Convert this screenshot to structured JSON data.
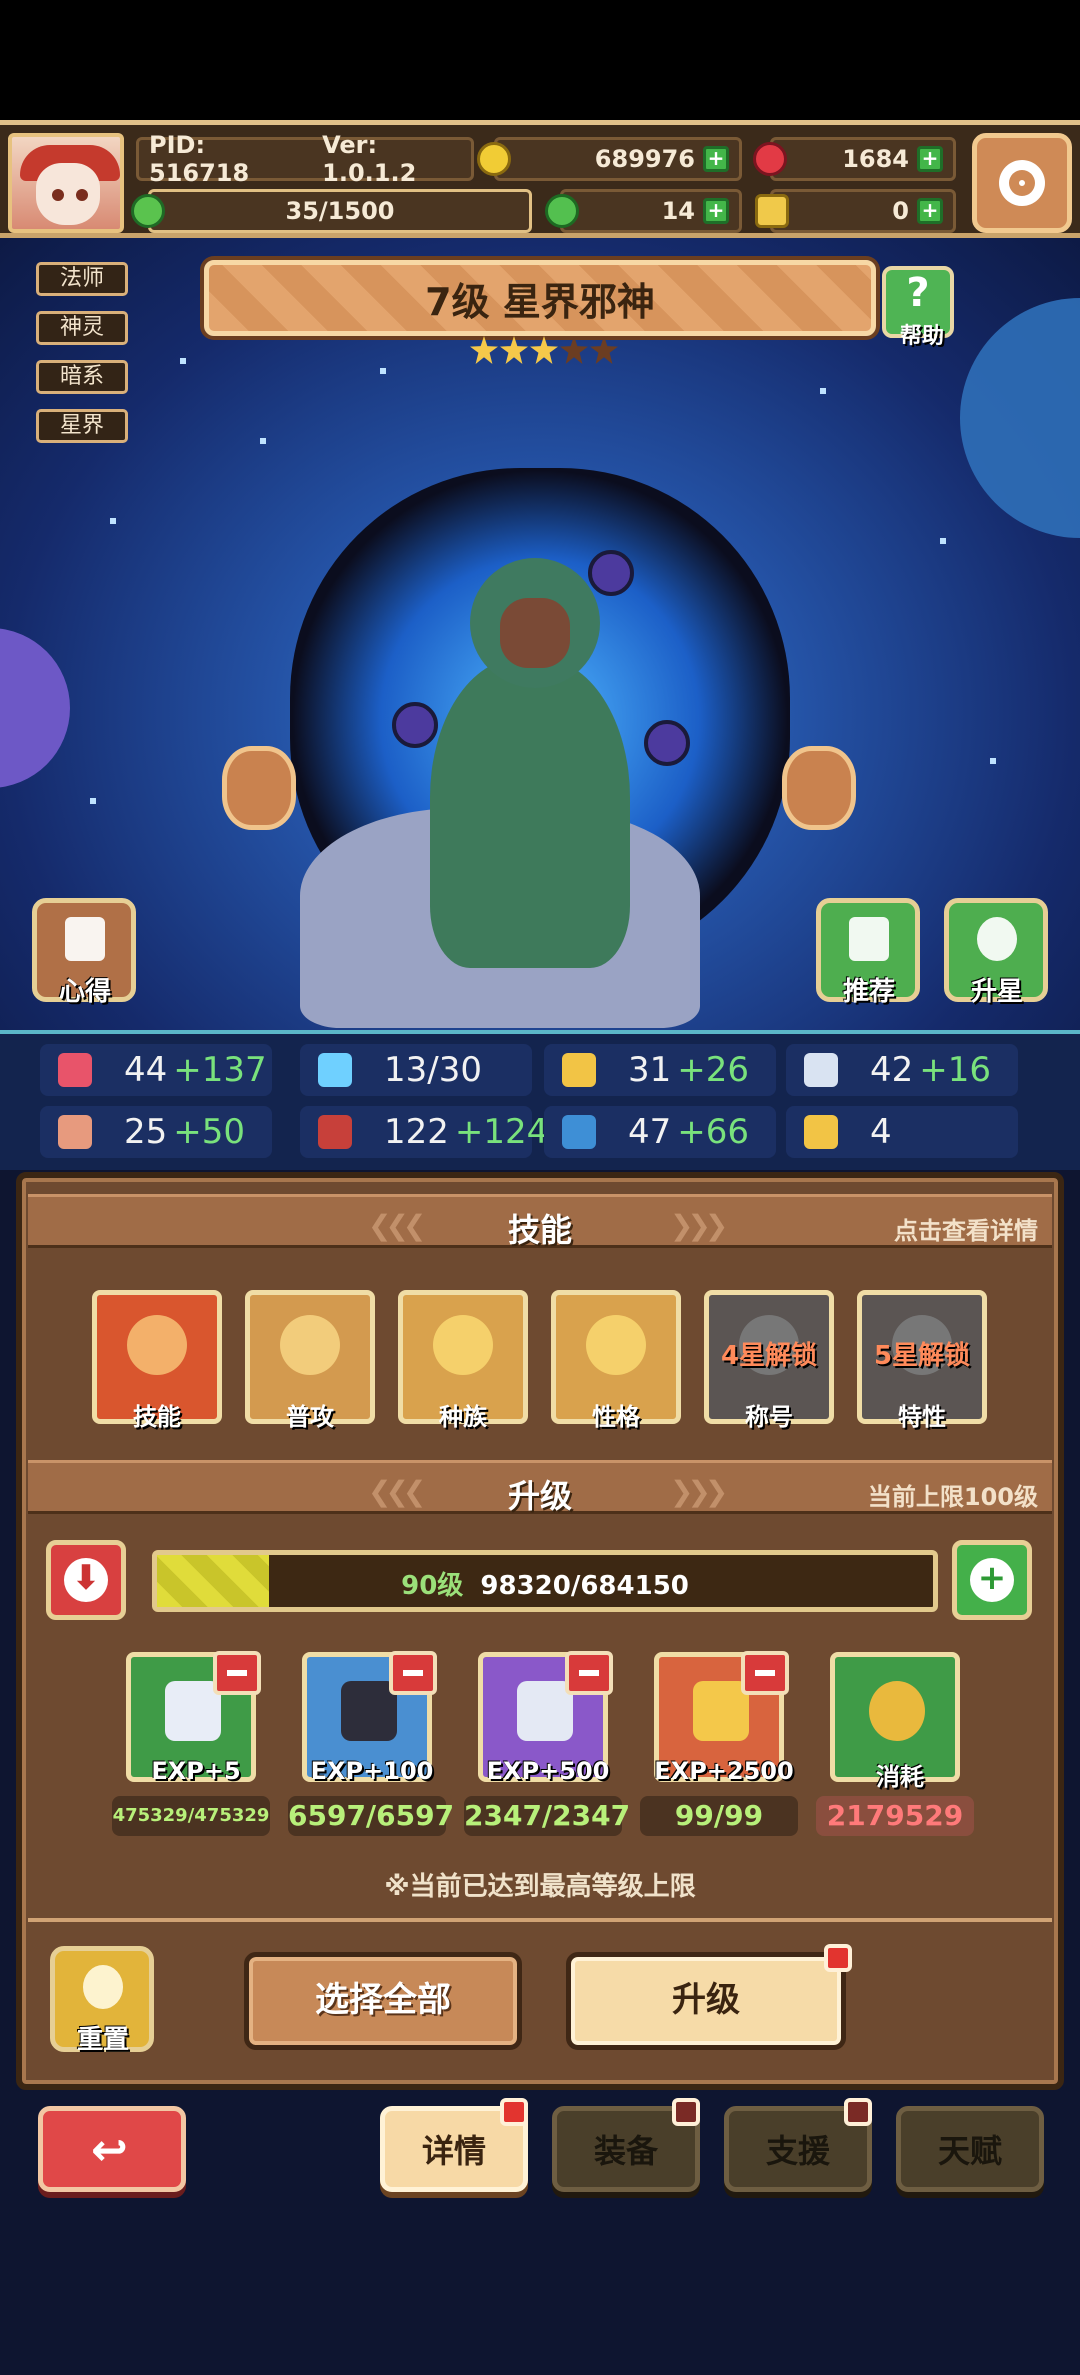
{
  "header": {
    "pid": "PID: 516718",
    "version": "Ver: 1.0.1.2",
    "gold": "689976",
    "gems": "1684",
    "stamina": "35/1500",
    "clover": "14",
    "key": "0"
  },
  "tags": [
    "法师",
    "神灵",
    "暗系",
    "星界"
  ],
  "hero": {
    "title": "7级  星界邪神",
    "stars_filled": 3,
    "stars_total": 5,
    "help_label": "帮助"
  },
  "side_buttons": {
    "notes": "心得",
    "recommend": "推荐",
    "star_up": "升星"
  },
  "stats": [
    {
      "icon": "heart-icon",
      "base": "44",
      "bonus": "+137",
      "color": "#e8546a"
    },
    {
      "icon": "drop-icon",
      "base": "13/30",
      "bonus": "",
      "color": "#6fd0ff"
    },
    {
      "icon": "shield-icon",
      "base": "31",
      "bonus": "+26",
      "color": "#f2c445"
    },
    {
      "icon": "wing-icon",
      "base": "42",
      "bonus": "+16",
      "color": "#d9e3f2"
    },
    {
      "icon": "fist-icon",
      "base": "25",
      "bonus": "+50",
      "color": "#e79a7e"
    },
    {
      "icon": "book-icon",
      "base": "122",
      "bonus": "+124",
      "color": "#c7403a"
    },
    {
      "icon": "boot-icon",
      "base": "47",
      "bonus": "+66",
      "color": "#3e8fd6"
    },
    {
      "icon": "crown-icon",
      "base": "4",
      "bonus": "",
      "color": "#f2c445"
    }
  ],
  "skills_section": {
    "title": "技能",
    "hint": "点击查看详情",
    "items": [
      {
        "label": "技能",
        "lock": "",
        "bg": "#d9562e",
        "art": "#f3b06a"
      },
      {
        "label": "普攻",
        "lock": "",
        "bg": "#d39a4f",
        "art": "#f2cc7b"
      },
      {
        "label": "种族",
        "lock": "",
        "bg": "#d9a24d",
        "art": "#f5d06b"
      },
      {
        "label": "性格",
        "lock": "",
        "bg": "#d9a24d",
        "art": "#f5d06b"
      },
      {
        "label": "称号",
        "lock": "4星解锁",
        "bg": "#5b5553",
        "art": "#777"
      },
      {
        "label": "特性",
        "lock": "5星解锁",
        "bg": "#5b5553",
        "art": "#777"
      }
    ]
  },
  "upgrade_section": {
    "title": "升级",
    "hint": "当前上限100级",
    "level": "90级",
    "exp": "98320/684150",
    "exp_fraction": 0.144,
    "items": [
      {
        "label": "EXP+5",
        "count": "475329/475329",
        "bg": "#3f9b47",
        "gem": "#e8edf7",
        "minus": true
      },
      {
        "label": "EXP+100",
        "count": "6597/6597",
        "bg": "#4a8fd1",
        "gem": "#2d2d3a",
        "minus": true
      },
      {
        "label": "EXP+500",
        "count": "2347/2347",
        "bg": "#8a58c9",
        "gem": "#e4e9f4",
        "minus": true
      },
      {
        "label": "EXP+2500",
        "count": "99/99",
        "bg": "#d8643e",
        "gem": "#f4c84a",
        "minus": true
      },
      {
        "label": "消耗",
        "count": "2179529",
        "bg": "#3f9b47",
        "gem": "#e9b93d",
        "minus": false
      }
    ],
    "note": "※当前已达到最高等级上限"
  },
  "actions": {
    "reset": "重置",
    "select_all": "选择全部",
    "upgrade": "升级"
  },
  "tabs": {
    "details": "详情",
    "equipment": "装备",
    "support": "支援",
    "talent": "天赋"
  }
}
